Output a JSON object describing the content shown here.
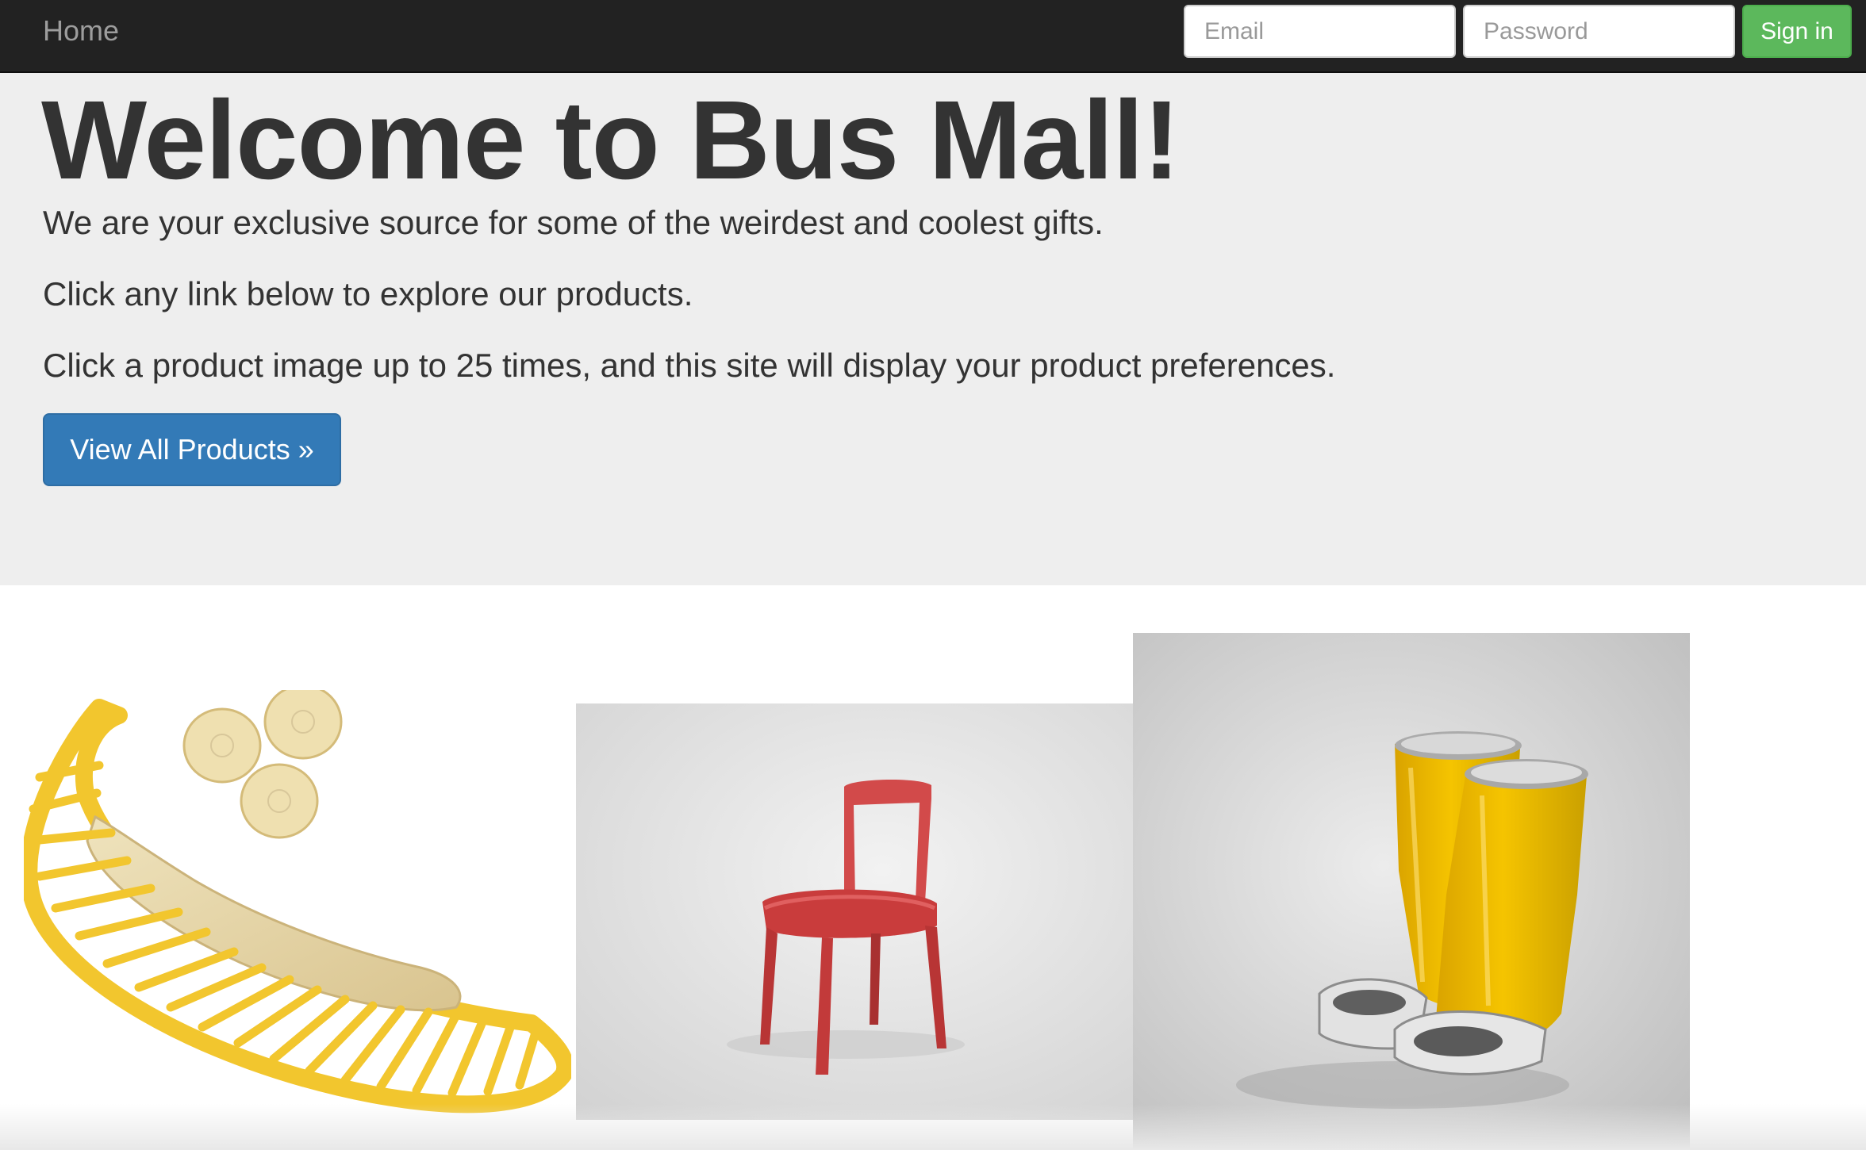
{
  "navbar": {
    "brand": "Home",
    "email_placeholder": "Email",
    "password_placeholder": "Password",
    "signin_label": "Sign in"
  },
  "jumbotron": {
    "title": "Welcome to Bus Mall!",
    "lines": [
      "We are your exclusive source for some of the weirdest and coolest gifts.",
      "Click any link below to explore our products.",
      "Click a product image up to 25 times, and this site will display your product preferences."
    ],
    "cta_label": "View All Products »"
  },
  "products": [
    {
      "name": "banana",
      "icon": "banana-slicer-image"
    },
    {
      "name": "chair",
      "icon": "red-chair-image"
    },
    {
      "name": "boots",
      "icon": "yellow-boots-image"
    }
  ],
  "colors": {
    "navbar_bg": "#222222",
    "signin_bg": "#5cb85c",
    "cta_bg": "#337ab7",
    "jumbotron_bg": "#eeeeee"
  }
}
